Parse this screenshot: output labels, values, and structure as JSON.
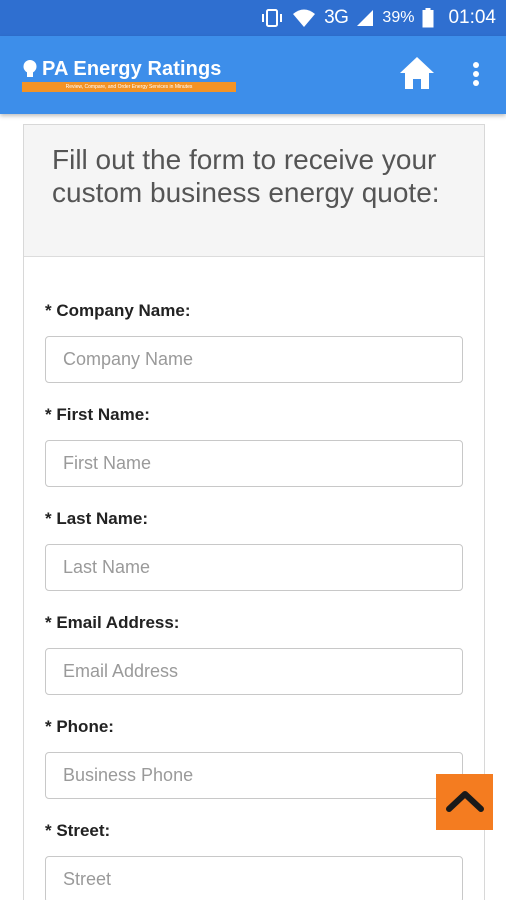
{
  "status_bar": {
    "network": "3G",
    "battery": "39%",
    "time": "01:04"
  },
  "app_bar": {
    "logo_title": "PA Energy Ratings",
    "logo_tagline": "Review, Compare, and Order Energy Services in Minutes",
    "icons": [
      "home-icon",
      "more-vert-icon"
    ],
    "colors": {
      "status": "#2f6fd0",
      "bar": "#3d8eea",
      "accent": "#f39325"
    }
  },
  "form": {
    "heading": "Fill out the form to receive your custom business energy quote:",
    "fields": [
      {
        "label": "* Company Name:",
        "placeholder": "Company Name"
      },
      {
        "label": "* First Name:",
        "placeholder": "First Name"
      },
      {
        "label": "* Last Name:",
        "placeholder": "Last Name"
      },
      {
        "label": "* Email Address:",
        "placeholder": "Email Address"
      },
      {
        "label": "* Phone:",
        "placeholder": "Business Phone"
      },
      {
        "label": "* Street:",
        "placeholder": "Street"
      }
    ]
  },
  "scroll_top": {
    "icon": "chevron-up-icon",
    "color": "#f47c20"
  }
}
